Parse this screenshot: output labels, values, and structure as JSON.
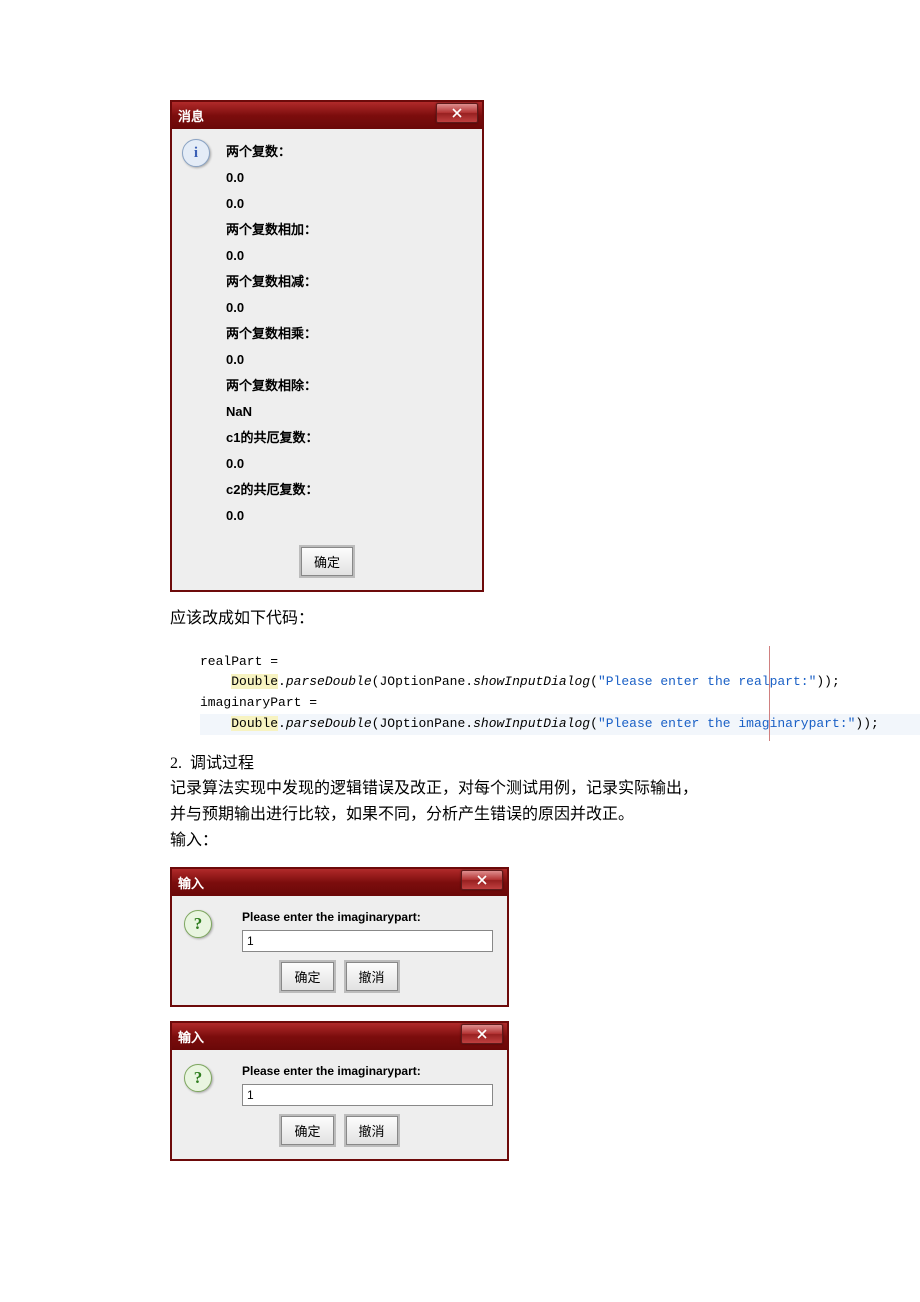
{
  "message_dialog": {
    "title": "消息",
    "lines": [
      "两个复数：",
      "0.0",
      "0.0",
      "两个复数相加：",
      "0.0",
      "两个复数相减：",
      "0.0",
      "两个复数相乘：",
      "0.0",
      "两个复数相除：",
      "NaN",
      "c1的共厄复数：",
      "0.0",
      "c2的共厄复数：",
      "0.0"
    ],
    "ok_label": "确定"
  },
  "para1": "应该改成如下代码：",
  "code": {
    "l1_a": "realPart =",
    "l2_class": "Double",
    "l2_dot": ".",
    "l2_method": "parseDouble",
    "l2_lp": "(JOptionPane.",
    "l2_call": "showInputDialog",
    "l2_lp2": "(",
    "l2_str": "\"Please enter the realpart:\"",
    "l2_rp": "));",
    "l3_a": "imaginaryPart =",
    "l4_str": "\"Please enter the imaginarypart:\"",
    "l4_rp": "));"
  },
  "section": {
    "num": "2.",
    "title": "调试过程",
    "p1": "记录算法实现中发现的逻辑错误及改正，对每个测试用例，记录实际输出，",
    "p2": "并与预期输出进行比较，如果不同，分析产生错误的原因并改正。",
    "p3": "输入："
  },
  "input_dialog": {
    "title": "输入",
    "prompt": "Please enter the imaginarypart:",
    "value": "1",
    "ok_label": "确定",
    "cancel_label": "撤消"
  }
}
